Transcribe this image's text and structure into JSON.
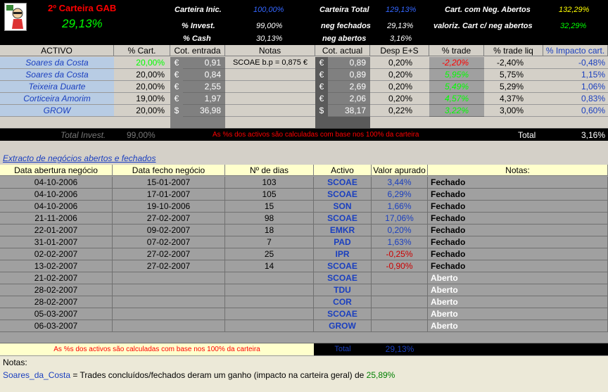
{
  "header": {
    "title": "2º Carteira GAB",
    "big_pct": "29,13%",
    "carteira_inic_label": "Carteira Inic.",
    "carteira_inic_val": "100,00%",
    "invest_label": "% Invest.",
    "invest_val": "99,00%",
    "cash_label": "%  Cash",
    "cash_val": "30,13%",
    "carteira_total_label": "Carteira Total",
    "carteira_total_val": "129,13%",
    "neg_fechados_label": "neg fechados",
    "neg_fechados_val": "29,13%",
    "neg_abertos_label": "neg abertos",
    "neg_abertos_val": "3,16%",
    "cart_neg_label": "Cart. com Neg. Abertos",
    "cart_neg_val": "132,29%",
    "valoriz_label": "valoriz. Cart c/ neg abertos",
    "valoriz_val": "32,29%"
  },
  "portfolio": {
    "columns": [
      "ACTIVO",
      "% Cart.",
      "Cot. entrada",
      "Notas",
      "Cot. actual",
      "Desp E+S",
      "% trade",
      "% trade liq",
      "% Impacto cart."
    ],
    "rows": [
      {
        "activo": "Soares da Costa",
        "cart": "20,00%",
        "cur1": "€",
        "entrada": "0,91",
        "notas": "SCOAE b.p = 0,875 €",
        "cur2": "€",
        "actual": "0,89",
        "desp": "0,20%",
        "trade": "-2,20%",
        "liq": "-2,40%",
        "impacto": "-0,48%"
      },
      {
        "activo": "Soares da Costa",
        "cart": "20,00%",
        "cur1": "€",
        "entrada": "0,84",
        "notas": "",
        "cur2": "€",
        "actual": "0,89",
        "desp": "0,20%",
        "trade": "5,95%",
        "liq": "5,75%",
        "impacto": "1,15%"
      },
      {
        "activo": "Teixeira Duarte",
        "cart": "20,00%",
        "cur1": "€",
        "entrada": "2,55",
        "notas": "",
        "cur2": "€",
        "actual": "2,69",
        "desp": "0,20%",
        "trade": "5,49%",
        "liq": "5,29%",
        "impacto": "1,06%"
      },
      {
        "activo": "Corticeira Amorim",
        "cart": "19,00%",
        "cur1": "€",
        "entrada": "1,97",
        "notas": "",
        "cur2": "€",
        "actual": "2,06",
        "desp": "0,20%",
        "trade": "4,57%",
        "liq": "4,37%",
        "impacto": "0,83%"
      },
      {
        "activo": "GROW",
        "cart": "20,00%",
        "cur1": "$",
        "entrada": "36,98",
        "notas": "",
        "cur2": "$",
        "actual": "38,17",
        "desp": "0,22%",
        "trade": "3,22%",
        "liq": "3,00%",
        "impacto": "0,60%"
      }
    ],
    "total_invest_label": "Total Invest.",
    "total_invest_val": "99,00%",
    "note_red": "As %s dos activos são calculadas com base nos 100% da carteira",
    "total_label": "Total",
    "total_val": "3,16%"
  },
  "extract": {
    "title": "Extracto de negócios abertos e fechados",
    "columns": [
      "Data abertura negócio",
      "Data fecho negócio",
      "Nº de dias",
      "Activo",
      "Valor apurado",
      "Notas:"
    ],
    "rows": [
      {
        "abertura": "04-10-2006",
        "fecho": "15-01-2007",
        "dias": "103",
        "activo": "SCOAE",
        "valor": "3,44%",
        "nota": "Fechado"
      },
      {
        "abertura": "04-10-2006",
        "fecho": "17-01-2007",
        "dias": "105",
        "activo": "SCOAE",
        "valor": "6,29%",
        "nota": "Fechado"
      },
      {
        "abertura": "04-10-2006",
        "fecho": "19-10-2006",
        "dias": "15",
        "activo": "SON",
        "valor": "1,66%",
        "nota": "Fechado"
      },
      {
        "abertura": "21-11-2006",
        "fecho": "27-02-2007",
        "dias": "98",
        "activo": "SCOAE",
        "valor": "17,06%",
        "nota": "Fechado"
      },
      {
        "abertura": "22-01-2007",
        "fecho": "09-02-2007",
        "dias": "18",
        "activo": "EMKR",
        "valor": "0,20%",
        "nota": "Fechado"
      },
      {
        "abertura": "31-01-2007",
        "fecho": "07-02-2007",
        "dias": "7",
        "activo": "PAD",
        "valor": "1,63%",
        "nota": "Fechado"
      },
      {
        "abertura": "02-02-2007",
        "fecho": "27-02-2007",
        "dias": "25",
        "activo": "IPR",
        "valor": "-0,25%",
        "nota": "Fechado"
      },
      {
        "abertura": "13-02-2007",
        "fecho": "27-02-2007",
        "dias": "14",
        "activo": "SCOAE",
        "valor": "-0,90%",
        "nota": "Fechado"
      },
      {
        "abertura": "21-02-2007",
        "fecho": "",
        "dias": "",
        "activo": "SCOAE",
        "valor": "",
        "nota": "Aberto"
      },
      {
        "abertura": "28-02-2007",
        "fecho": "",
        "dias": "",
        "activo": "TDU",
        "valor": "",
        "nota": "Aberto"
      },
      {
        "abertura": "28-02-2007",
        "fecho": "",
        "dias": "",
        "activo": "COR",
        "valor": "",
        "nota": "Aberto"
      },
      {
        "abertura": "05-03-2007",
        "fecho": "",
        "dias": "",
        "activo": "SCOAE",
        "valor": "",
        "nota": "Aberto"
      },
      {
        "abertura": "06-03-2007",
        "fecho": "",
        "dias": "",
        "activo": "GROW",
        "valor": "",
        "nota": "Aberto"
      }
    ],
    "footer_note": "As %s dos activos são calculadas com base nos 100% da carteira",
    "total_label": "Total",
    "total_val": "29,13%"
  },
  "notes": {
    "label": "Notas:",
    "name": "Soares_da_Costa",
    "text": " = Trades concluídos/fechados deram um ganho (impacto na carteira geral) de ",
    "value": "25,89%"
  },
  "colors": {
    "green": "#00ff00",
    "red": "#ff0000",
    "blue": "#1a3fbf"
  }
}
